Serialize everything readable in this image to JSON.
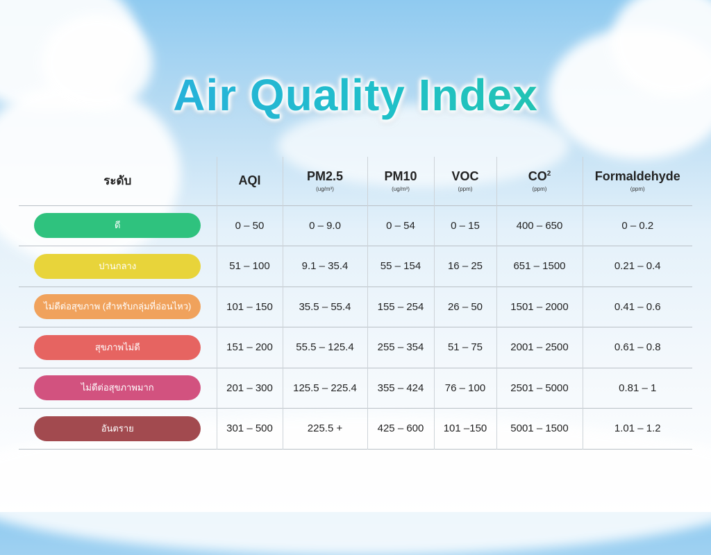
{
  "title": "Air Quality Index",
  "header": {
    "level": "ระดับ",
    "columns": [
      {
        "label": "AQI",
        "unit": ""
      },
      {
        "label": "PM2.5",
        "unit": "(ug/m³)"
      },
      {
        "label": "PM10",
        "unit": "(ug/m³)"
      },
      {
        "label": "VOC",
        "unit": "(ppm)"
      },
      {
        "label": "CO",
        "sup": "2",
        "unit": "(ppm)"
      },
      {
        "label": "Formaldehyde",
        "unit": "(ppm)"
      }
    ]
  },
  "rows": [
    {
      "level": "ดี",
      "color": "#2fc27e",
      "values": [
        "0 – 50",
        "0 – 9.0",
        "0 – 54",
        "0 – 15",
        "400 – 650",
        "0 – 0.2"
      ]
    },
    {
      "level": "ปานกลาง",
      "color": "#e8d43a",
      "values": [
        "51 – 100",
        "9.1 – 35.4",
        "55 – 154",
        "16 – 25",
        "651 – 1500",
        "0.21 – 0.4"
      ]
    },
    {
      "level": "ไม่ดีต่อสุขภาพ (สำหรับกลุ่มที่อ่อนไหว)",
      "color": "#f0a25c",
      "values": [
        "101 – 150",
        "35.5 – 55.4",
        "155 – 254",
        "26 – 50",
        "1501 – 2000",
        "0.41 – 0.6"
      ]
    },
    {
      "level": "สุขภาพไม่ดี",
      "color": "#e66461",
      "values": [
        "151 – 200",
        "55.5 – 125.4",
        "255 – 354",
        "51 – 75",
        "2001 – 2500",
        "0.61 – 0.8"
      ]
    },
    {
      "level": "ไม่ดีต่อสุขภาพมาก",
      "color": "#d2527f",
      "values": [
        "201 – 300",
        "125.5 – 225.4",
        "355 – 424",
        "76 – 100",
        "2501 – 5000",
        "0.81  – 1"
      ]
    },
    {
      "level": "อันตราย",
      "color": "#a24a4f",
      "values": [
        "301 – 500",
        "225.5 +",
        "425 – 600",
        "101 –150",
        "5001 – 1500",
        "1.01 – 1.2"
      ]
    }
  ]
}
